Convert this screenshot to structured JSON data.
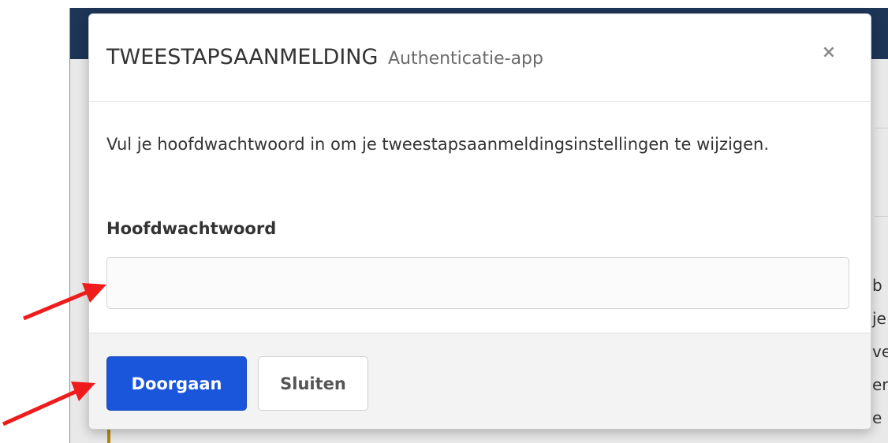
{
  "modal": {
    "title": "TWEESTAPSAANMELDING",
    "subtitle": "Authenticatie-app",
    "close_label": "×",
    "body_text": "Vul je hoofdwachtwoord in om je tweestapsaanmeldingsinstellingen te wijzigen.",
    "field_label": "Hoofdwachtwoord",
    "password_value": "",
    "primary_button": "Doorgaan",
    "secondary_button": "Sluiten"
  },
  "background": {
    "side_text_fragments": [
      "b",
      "je",
      "ve",
      "er",
      "e"
    ]
  },
  "colors": {
    "primary": "#1a56db",
    "navbar": "#1d3557",
    "annotation": "#ee1c1c"
  },
  "icons": {
    "close": "close-icon",
    "arrows": "annotation-arrow"
  }
}
